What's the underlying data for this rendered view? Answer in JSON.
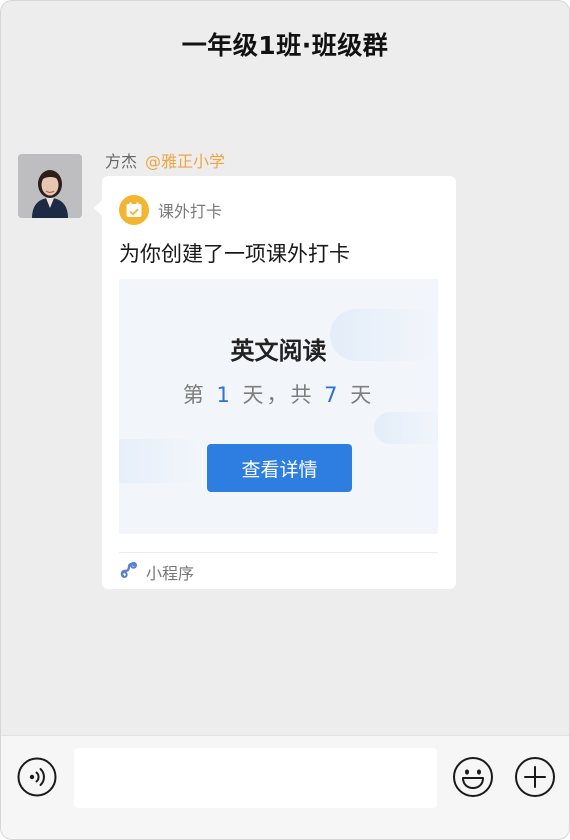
{
  "header": {
    "title": "一年级1班·班级群"
  },
  "message": {
    "sender_name": "方杰",
    "sender_tag": "@雅正小学",
    "app_name": "课外打卡",
    "text": "为你创建了一项课外打卡",
    "card": {
      "title": "英文阅读",
      "progress_prefix": "第 ",
      "current_day": "1",
      "progress_middle": " 天，共 ",
      "total_days": "7",
      "progress_suffix": " 天",
      "button_label": "查看详情"
    },
    "footer_label": "小程序"
  },
  "icons": {
    "app": "calendar-icon",
    "mini_program": "link-icon",
    "voice": "voice-icon",
    "emoji": "emoji-icon",
    "plus": "plus-icon"
  },
  "colors": {
    "chat_background": "#ededed",
    "accent_blue": "#2e7ee2",
    "tag_orange": "#f0a542",
    "app_icon_yellow": "#f4b531"
  }
}
